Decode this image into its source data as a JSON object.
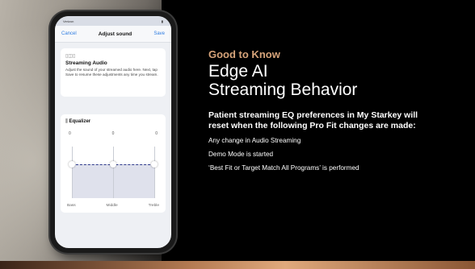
{
  "phone": {
    "status": {
      "carrier": "Verizon",
      "time": "",
      "battery": ""
    },
    "nav": {
      "cancel": "Cancel",
      "title": "Adjust sound",
      "save": "Save"
    },
    "streaming": {
      "icon": "streaming-icon",
      "title": "Streaming Audio",
      "description": "Adjust the sound of your streamed audio here. Next, tap Save to resume these adjustments any time you stream."
    },
    "equalizer": {
      "icon": "equalizer-icon",
      "title": "Equalizer",
      "values": [
        "0",
        "0",
        "0"
      ],
      "bands": [
        "Bass",
        "Middle",
        "Treble"
      ],
      "levels": [
        0,
        0,
        0
      ]
    }
  },
  "content": {
    "eyebrow": "Good to Know",
    "title_line1": "Edge AI",
    "title_line2": "Streaming Behavior",
    "lead": "Patient streaming EQ preferences in My Starkey will reset when the following Pro Fit changes are made:",
    "bullets": [
      "Any change in Audio Streaming",
      "Demo Mode is started",
      "‘Best Fit or Target Match All Programs’ is performed"
    ]
  },
  "colors": {
    "accent": "#d7a47a",
    "link": "#2f7de1",
    "background": "#000000"
  }
}
